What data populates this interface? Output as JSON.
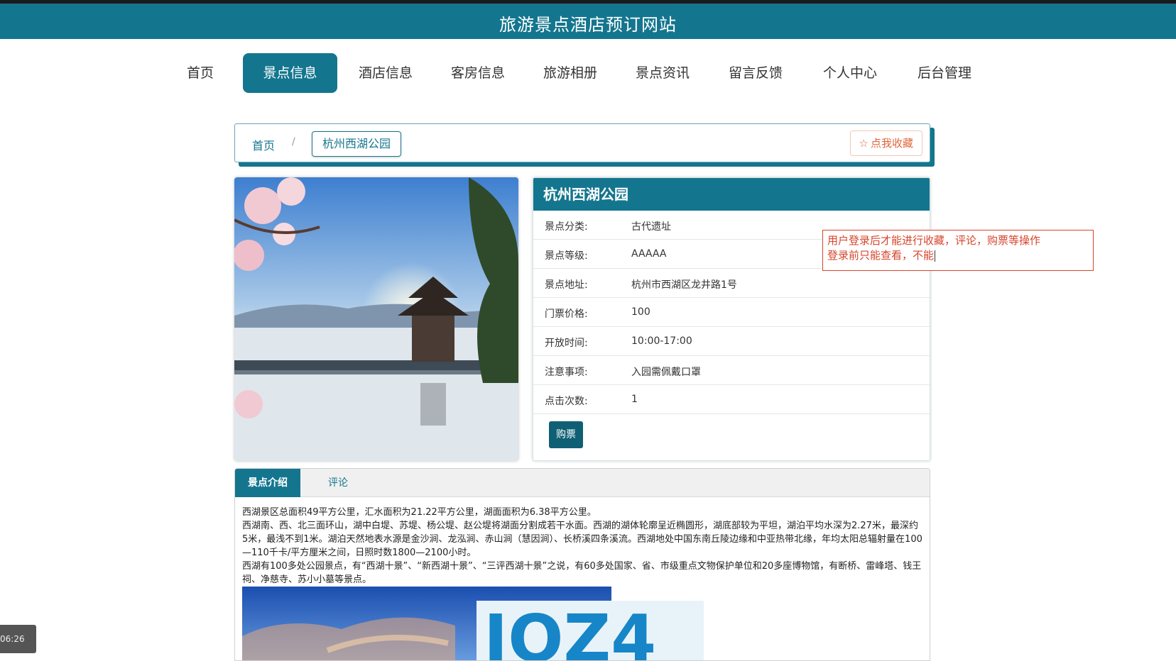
{
  "site": {
    "title": "旅游景点酒店预订网站"
  },
  "nav": {
    "items": [
      {
        "label": "首页"
      },
      {
        "label": "景点信息"
      },
      {
        "label": "酒店信息"
      },
      {
        "label": "客房信息"
      },
      {
        "label": "旅游相册"
      },
      {
        "label": "景点资讯"
      },
      {
        "label": "留言反馈"
      },
      {
        "label": "个人中心"
      },
      {
        "label": "后台管理"
      }
    ],
    "active_index": 1
  },
  "breadcrumb": {
    "home": "首页",
    "separator": "/",
    "current": "杭州西湖公园",
    "favorite_label": "点我收藏",
    "favorite_icon": "star-outline-icon"
  },
  "attraction": {
    "name": "杭州西湖公园",
    "fields": [
      {
        "key": "景点分类:",
        "value": "古代遗址"
      },
      {
        "key": "景点等级:",
        "value": "AAAAA"
      },
      {
        "key": "景点地址:",
        "value": "杭州市西湖区龙井路1号"
      },
      {
        "key": "门票价格:",
        "value": "100"
      },
      {
        "key": "开放时间:",
        "value": "10:00-17:00"
      },
      {
        "key": "注意事项:",
        "value": "入园需佩戴口罩"
      },
      {
        "key": "点击次数:",
        "value": "1"
      }
    ],
    "buy_label": "购票"
  },
  "note": {
    "line1": "用户登录后才能进行收藏，评论，购票等操作",
    "line2": "登录前只能查看，不能"
  },
  "tabs": {
    "items": [
      {
        "label": "景点介绍"
      },
      {
        "label": "评论"
      }
    ],
    "active_index": 0
  },
  "description": {
    "p1": "西湖景区总面积49平方公里，汇水面积为21.22平方公里，湖面面积为6.38平方公里。",
    "p2": "西湖南、西、北三面环山，湖中白堤、苏堤、杨公堤、赵公堤将湖面分割成若干水面。西湖的湖体轮廓呈近椭圆形，湖底部较为平坦，湖泊平均水深为2.27米，最深约5米，最浅不到1米。湖泊天然地表水源是金沙涧、龙泓涧、赤山涧（慧因涧）、长桥溪四条溪流。西湖地处中国东南丘陵边缘和中亚热带北缘，年均太阳总辐射量在100—110千卡/平方厘米之间，日照时数1800—2100小时。",
    "p3": "西湖有100多处公园景点，有“西湖十景”、“新西湖十景”、“三评西湖十景”之说，有60多处国家、省、市级重点文物保护单位和20多座博物馆，有断桥、雷峰塔、钱王祠、净慈寺、苏小小墓等景点。"
  },
  "overlay_logo_text": "IOZ4",
  "recording_timer": "06:26",
  "colors": {
    "primary": "#14768e",
    "accent_red": "#d6452c"
  }
}
